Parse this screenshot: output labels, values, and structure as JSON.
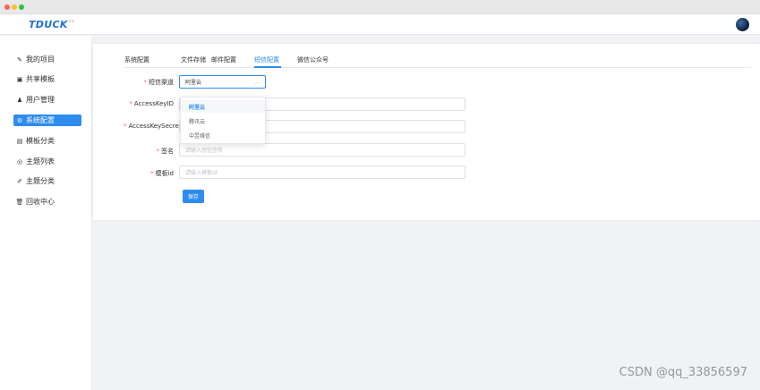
{
  "window": {
    "controls": [
      "close",
      "minimize",
      "maximize"
    ]
  },
  "header": {
    "logo": "TDUCK",
    "logo_sup": "vx",
    "avatar_icon": "user-avatar"
  },
  "sidebar": {
    "items": [
      {
        "label": "我的项目",
        "icon": "edit-icon",
        "glyph": "✎",
        "active": false
      },
      {
        "label": "共享模板",
        "icon": "template-icon",
        "glyph": "▣",
        "active": false
      },
      {
        "label": "用户管理",
        "icon": "user-icon",
        "glyph": "♟",
        "active": false
      },
      {
        "label": "系统配置",
        "icon": "gear-icon",
        "glyph": "⚙",
        "active": true
      },
      {
        "label": "模板分类",
        "icon": "category-icon",
        "glyph": "▤",
        "active": false
      },
      {
        "label": "主题列表",
        "icon": "eye-icon",
        "glyph": "◎",
        "active": false
      },
      {
        "label": "主题分类",
        "icon": "brush-icon",
        "glyph": "✐",
        "active": false
      },
      {
        "label": "回收中心",
        "icon": "trash-icon",
        "glyph": "🗑",
        "active": false
      }
    ]
  },
  "tabs": [
    {
      "label": "系统配置",
      "active": false
    },
    {
      "label": "文件存储",
      "active": false
    },
    {
      "label": "邮件配置",
      "active": false
    },
    {
      "label": "短信配置",
      "active": true
    },
    {
      "label": "微信公众号",
      "active": false
    }
  ],
  "form": {
    "channel": {
      "label": "短信渠道",
      "value": "阿里云"
    },
    "access_key_id": {
      "label": "AccessKeyID",
      "placeholder": ""
    },
    "access_key_secret": {
      "label": "AccessKeySecre",
      "placeholder": ""
    },
    "sign": {
      "label": "签名",
      "placeholder": "请输入短信签名"
    },
    "template_id": {
      "label": "模板id",
      "placeholder": "请输入模板id"
    },
    "save_label": "保存"
  },
  "dropdown": {
    "options": [
      "阿里云",
      "腾讯云",
      "中昱维信"
    ],
    "selected": "阿里云"
  },
  "watermark": "CSDN @qq_33856597",
  "colors": {
    "primary": "#2d8cf0",
    "required": "#f56c6c",
    "background": "#f0f2f5"
  }
}
